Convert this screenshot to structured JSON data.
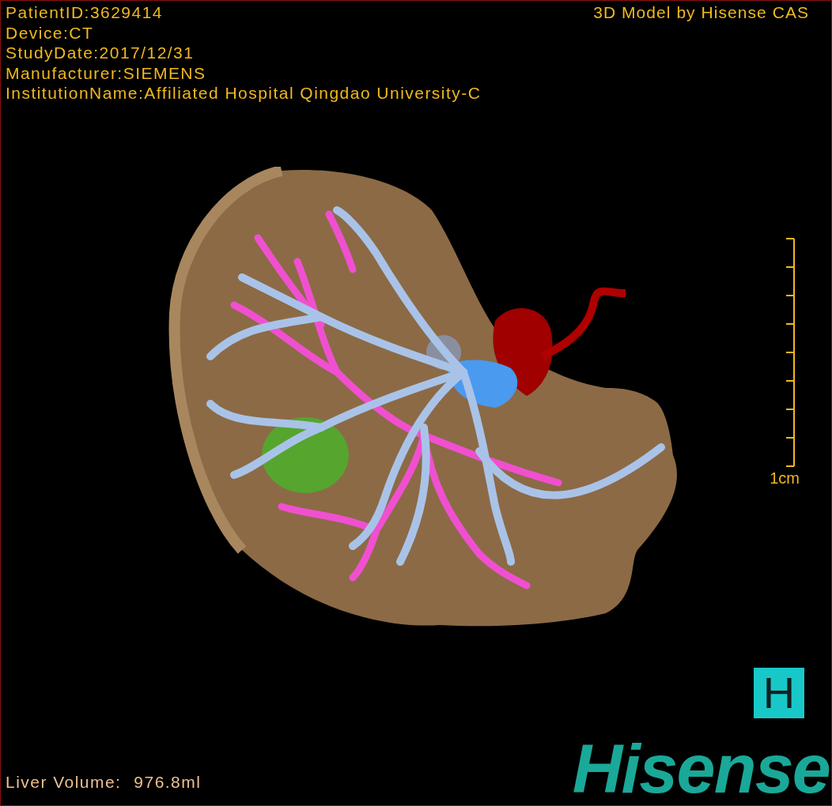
{
  "info_lines": [
    "PatientID:3629414",
    "Device:CT",
    "StudyDate:2017/12/31",
    "Manufacturer:SIEMENS",
    "InstitutionName:Affiliated Hospital Qingdao University-C"
  ],
  "title": "3D Model by Hisense CAS",
  "scale": {
    "label": "1cm"
  },
  "volume": {
    "label": "Liver Volume:",
    "value": "976.8ml"
  },
  "logo": {
    "mark": "H",
    "wordmark": "Hisense"
  }
}
